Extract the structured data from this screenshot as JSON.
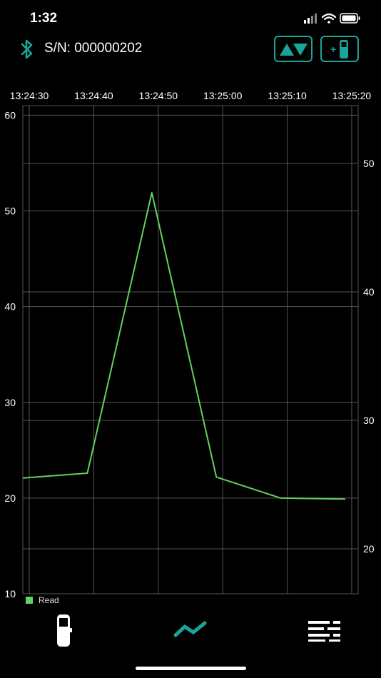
{
  "status_bar": {
    "time": "1:32"
  },
  "header": {
    "serial": "S/N: 000000202"
  },
  "colors": {
    "accent": "#1aa59b",
    "series": "#5fd35f",
    "grid": "#555555",
    "background": "#000000"
  },
  "icons": {
    "bluetooth": "bluetooth-icon",
    "sort": "up-down-triangles-icon",
    "add_device": "add-device-icon",
    "tab_device": "device-icon",
    "tab_chart": "trend-chart-icon",
    "tab_list": "list-icon"
  },
  "chart_data": {
    "type": "line",
    "x_axis": {
      "position": "top",
      "ticks": [
        "13:24:30",
        "13:24:40",
        "13:24:50",
        "13:25:00",
        "13:25:10",
        "13:25:20"
      ],
      "range": [
        "13:24:29",
        "13:25:21"
      ]
    },
    "y_axis_left": {
      "ticks": [
        10,
        20,
        30,
        40,
        50,
        60
      ],
      "range": [
        10,
        61
      ]
    },
    "y_axis_right": {
      "ticks": [
        20,
        30,
        40,
        50
      ],
      "range": [
        16.5,
        54.5
      ]
    },
    "grid": true,
    "legend": "bottom-left",
    "series": [
      {
        "name": "Read",
        "color": "#5fd35f",
        "axis": "left",
        "points": [
          {
            "x": "13:24:29",
            "y": 22.1
          },
          {
            "x": "13:24:39",
            "y": 22.6
          },
          {
            "x": "13:24:49",
            "y": 51.9
          },
          {
            "x": "13:24:59",
            "y": 22.2
          },
          {
            "x": "13:25:09",
            "y": 20.0
          },
          {
            "x": "13:25:19",
            "y": 19.9
          }
        ]
      }
    ]
  }
}
